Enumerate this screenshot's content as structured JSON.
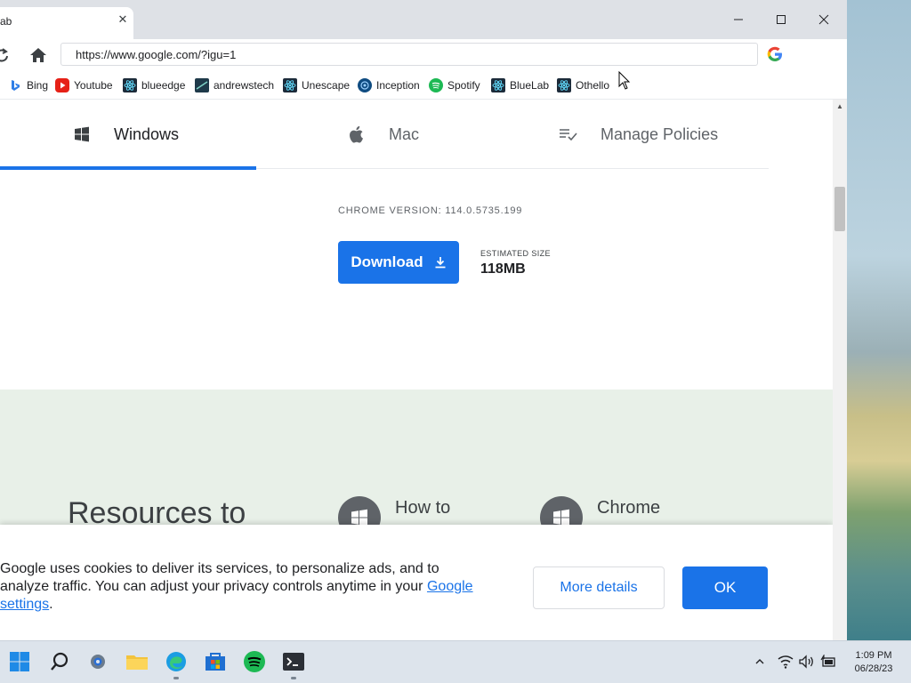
{
  "browser": {
    "tab_title": "ab",
    "url": "https://www.google.com/?igu=1"
  },
  "bookmarks": [
    {
      "label": "Bing",
      "icon": "bing-icon",
      "color": "#2f7ee6"
    },
    {
      "label": "Youtube",
      "icon": "youtube-icon",
      "color": "#e62117"
    },
    {
      "label": "blueedge",
      "icon": "react-icon",
      "color": "#1c2b3a"
    },
    {
      "label": "andrewstech",
      "icon": "andrewstech-icon",
      "color": "#1f3a4a"
    },
    {
      "label": "Unescape",
      "icon": "react-icon",
      "color": "#1c2b3a"
    },
    {
      "label": "Inception",
      "icon": "inception-icon",
      "color": "#0f4c81"
    },
    {
      "label": "Spotify",
      "icon": "spotify-icon",
      "color": "#1db954"
    },
    {
      "label": "BlueLab",
      "icon": "react-icon",
      "color": "#1c2b3a"
    },
    {
      "label": "Othello",
      "icon": "react-icon",
      "color": "#1c2b3a"
    }
  ],
  "os_tabs": [
    {
      "label": "Windows",
      "icon": "windows-icon",
      "active": true
    },
    {
      "label": "Mac",
      "icon": "apple-icon",
      "active": false
    },
    {
      "label": "Manage Policies",
      "icon": "policy-list-icon",
      "active": false
    }
  ],
  "download": {
    "version_text": "CHROME VERSION: 114.0.5735.199",
    "button_label": "Download",
    "est_size_label": "ESTIMATED SIZE",
    "est_size_value": "118MB"
  },
  "resources": {
    "heading": "Resources to",
    "items": [
      {
        "label": "How to"
      },
      {
        "label": "Chrome"
      }
    ]
  },
  "cookie": {
    "text": "Google uses cookies to deliver its services, to personalize ads, and to analyze traffic. You can adjust your privacy controls anytime in your",
    "link_text": "Google settings",
    "trailing": ".",
    "more_label": "More details",
    "ok_label": "OK"
  },
  "taskbar": {
    "time": "1:09 PM",
    "date": "06/28/23"
  },
  "colors": {
    "accent": "#1a73e8",
    "chrome_bar": "#dee1e6"
  }
}
